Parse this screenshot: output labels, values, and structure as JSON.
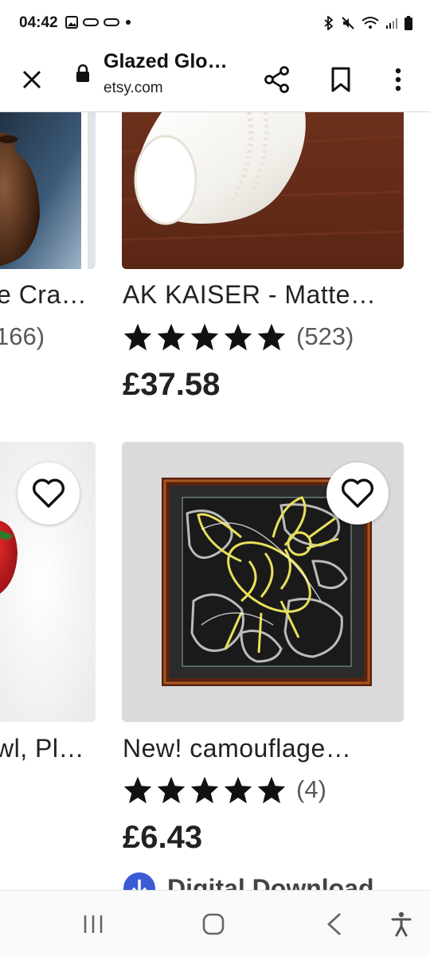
{
  "status_bar": {
    "time": "04:42"
  },
  "toolbar": {
    "title": "Glazed Glo…",
    "url": "etsy.com"
  },
  "products": [
    {
      "title": "e Cra…",
      "review_count": "166)"
    },
    {
      "title": "AK KAISER - Matte…",
      "review_count": "(523)",
      "rating": 5,
      "price": "£37.58"
    },
    {
      "title": "wl, Pl…"
    },
    {
      "title": "New! camouflage…",
      "review_count": "(4)",
      "rating": 5,
      "price": "£6.43",
      "badge": "Digital Download"
    }
  ],
  "colors": {
    "star": "#111111",
    "wood": "#6b2f1b",
    "mat_gray": "#d9d9d9"
  }
}
